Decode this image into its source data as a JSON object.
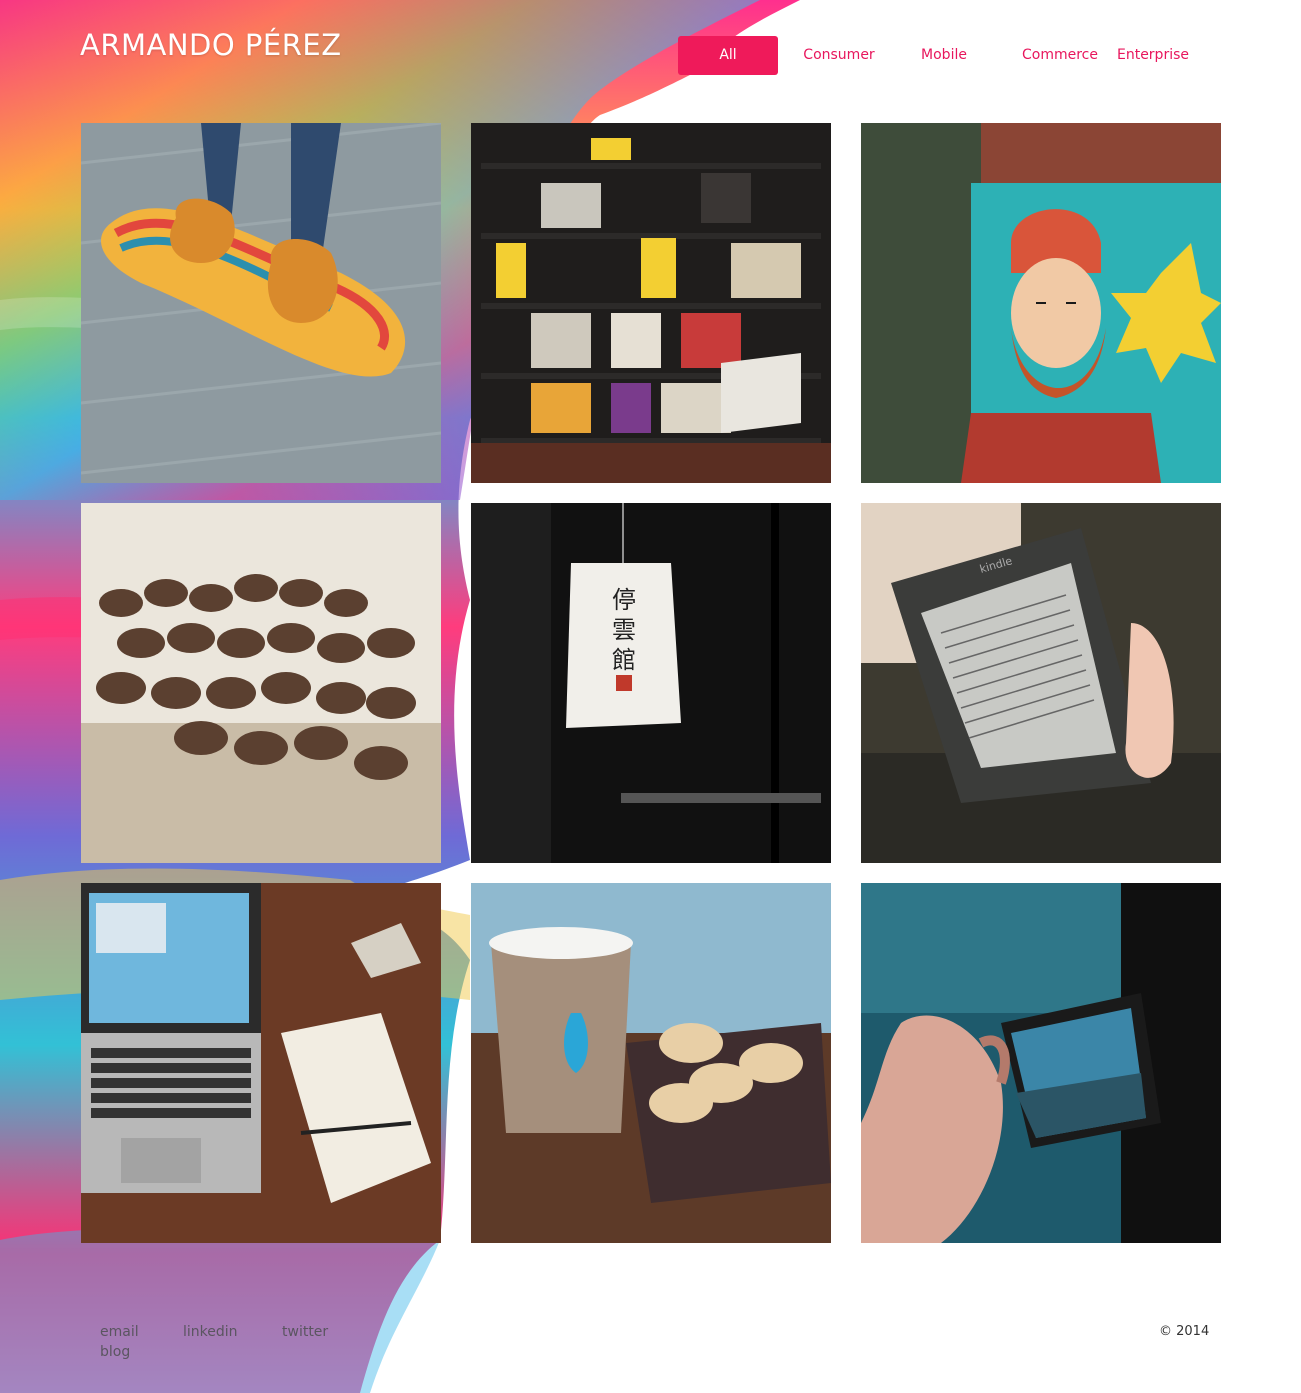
{
  "site": {
    "title": "ARMANDO PÉREZ"
  },
  "nav": {
    "items": [
      {
        "label": "All",
        "active": true
      },
      {
        "label": "Consumer",
        "active": false
      },
      {
        "label": "Mobile",
        "active": false
      },
      {
        "label": "Commerce",
        "active": false
      },
      {
        "label": "Enterprise",
        "active": false
      }
    ]
  },
  "gallery": {
    "tiles": [
      {
        "subject": "orange-shoes-on-skateboard"
      },
      {
        "subject": "bookshelf-with-chair"
      },
      {
        "subject": "bearded-man-mural"
      },
      {
        "subject": "coffee-beans"
      },
      {
        "subject": "paper-lantern",
        "lantern_text": "停雲館"
      },
      {
        "subject": "kindle-e-reader",
        "device_label": "kindle"
      },
      {
        "subject": "laptop-and-notebook"
      },
      {
        "subject": "coffee-cup-and-macarons"
      },
      {
        "subject": "phone-taking-photo"
      }
    ]
  },
  "footer": {
    "links": [
      {
        "label": "email"
      },
      {
        "label": "linkedin"
      },
      {
        "label": "twitter"
      },
      {
        "label": "blog"
      }
    ],
    "copyright": "© 2014"
  },
  "colors": {
    "accent": "#ef1a5a",
    "nav_text": "#e8175d",
    "footer_text": "#5a5560"
  }
}
